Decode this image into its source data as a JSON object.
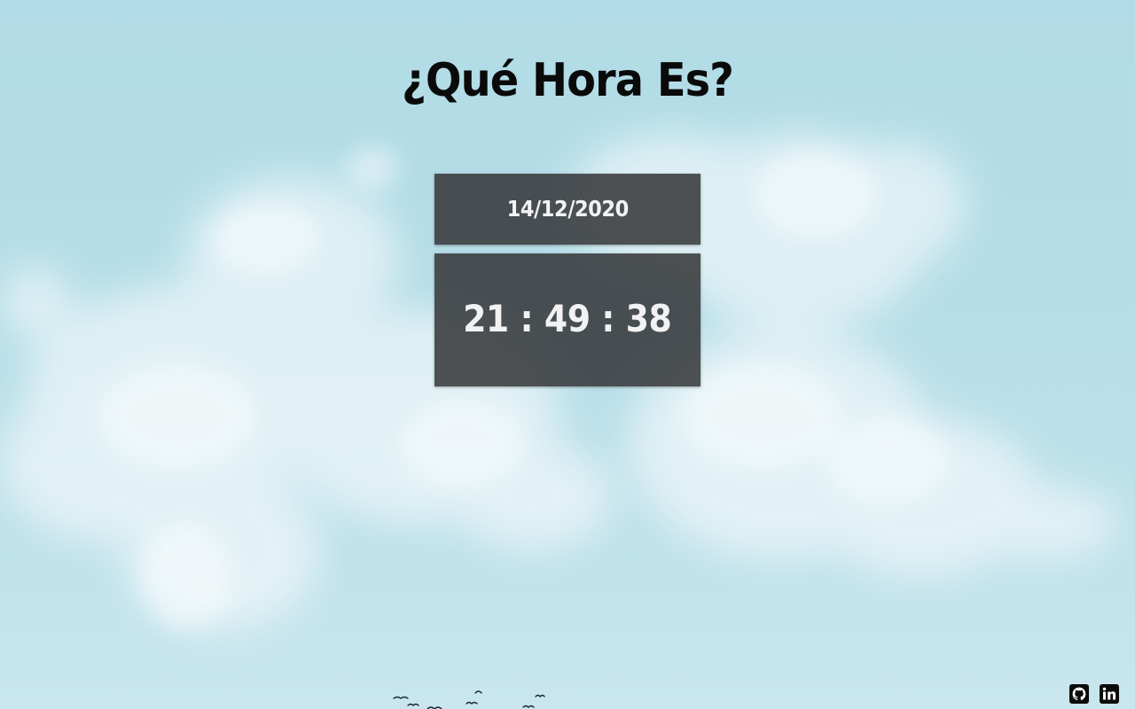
{
  "page": {
    "title": "¿Qué Hora Es?"
  },
  "clock": {
    "date": "14/12/2020",
    "time": "21 : 49 : 38"
  },
  "footer": {
    "links": [
      {
        "icon": "github-icon"
      },
      {
        "icon": "linkedin-icon"
      }
    ]
  },
  "colors": {
    "sky": "#b6dde7",
    "panel": "#343638",
    "panel_text": "#f2f2f2",
    "title_text": "#0a0a0a"
  }
}
